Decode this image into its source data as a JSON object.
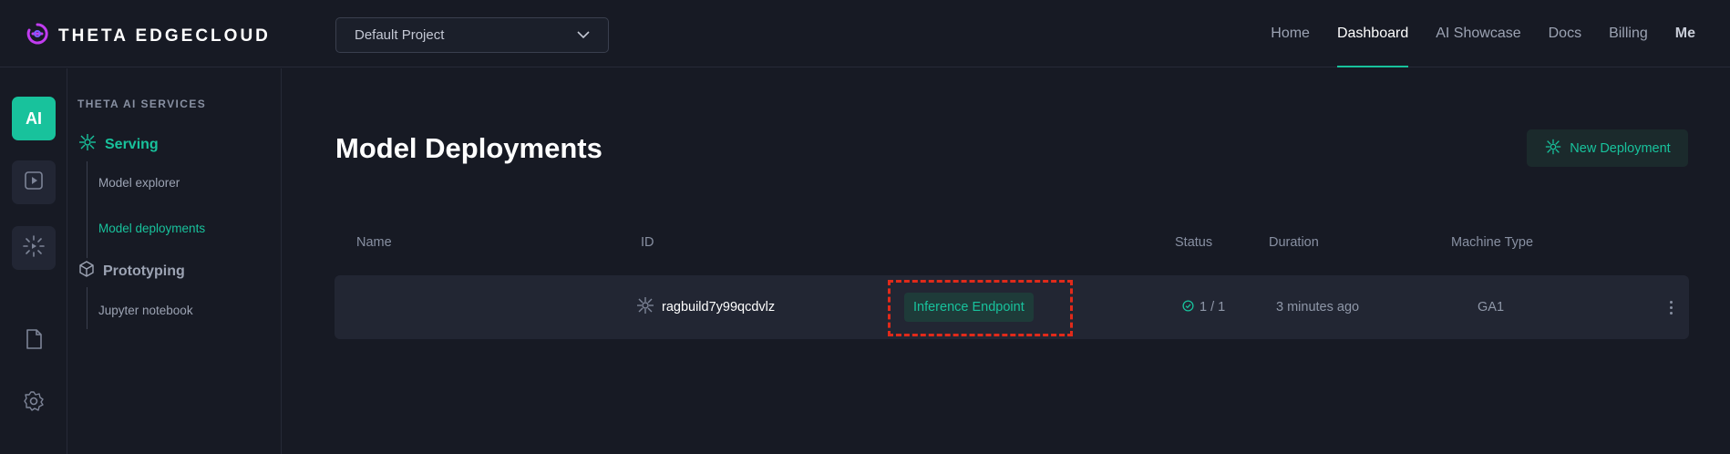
{
  "brand": {
    "name": "THETA EDGECLOUD"
  },
  "project_select": {
    "value": "Default Project"
  },
  "nav": [
    {
      "label": "Home"
    },
    {
      "label": "Dashboard"
    },
    {
      "label": "AI Showcase"
    },
    {
      "label": "Docs"
    },
    {
      "label": "Billing"
    },
    {
      "label": "Me"
    }
  ],
  "nav_active": "Dashboard",
  "rail": {
    "ai_label": "AI"
  },
  "sidebar": {
    "section_title": "THETA AI SERVICES",
    "groups": [
      {
        "label": "Serving",
        "items": [
          {
            "label": "Model explorer"
          },
          {
            "label": "Model deployments"
          }
        ]
      },
      {
        "label": "Prototyping",
        "items": [
          {
            "label": "Jupyter notebook"
          }
        ]
      }
    ],
    "active_item": "Model deployments"
  },
  "main": {
    "title": "Model Deployments",
    "new_button": "New Deployment",
    "columns": {
      "name": "Name",
      "id": "ID",
      "status": "Status",
      "duration": "Duration",
      "machine_type": "Machine Type"
    },
    "rows": [
      {
        "name": "",
        "id": "ragbuild7y99qcdvlz",
        "type": "Inference Endpoint",
        "status": "1 / 1",
        "duration": "3 minutes ago",
        "machine_type": "GA1"
      }
    ]
  },
  "colors": {
    "accent": "#18c29c",
    "background": "#171a24",
    "row": "#222633",
    "highlight": "#e02a1a"
  }
}
